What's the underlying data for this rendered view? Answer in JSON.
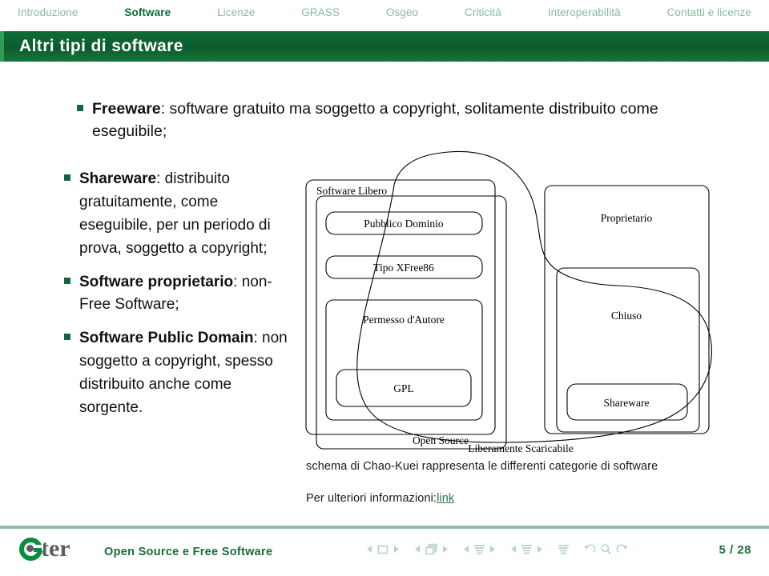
{
  "topnav": {
    "items": [
      {
        "label": "Introduzione",
        "active": false
      },
      {
        "label": "Software",
        "active": true
      },
      {
        "label": "Licenze",
        "active": false
      },
      {
        "label": "GRASS",
        "active": false
      },
      {
        "label": "Osgeo",
        "active": false
      },
      {
        "label": "Criticità",
        "active": false
      },
      {
        "label": "Interoperabilità",
        "active": false
      },
      {
        "label": "Contatti e licenze",
        "active": false
      }
    ],
    "inactive_color": "#84bc9c",
    "active_color": "#0b6b36"
  },
  "title": {
    "text": "Altri tipi di software",
    "bar_color": "#0c5c2c",
    "stripe_color": "#2f9c57",
    "text_color": "#ffffff"
  },
  "content": {
    "top_bullet": {
      "term": "Freeware",
      "rest": ": software gratuito ma soggetto a copyright, solitamente distribuito come eseguibile;"
    },
    "left_bullets": [
      {
        "term": "Shareware",
        "rest": ": distribuito gratuitamente, come eseguibile, per un periodo di prova, soggetto a copyright;"
      },
      {
        "term": "Software proprietario",
        "rest": ": non-Free Software;"
      },
      {
        "term": "Software Public Domain",
        "rest": ": non soggetto a copyright, spesso distribuito anche come sorgente."
      }
    ],
    "bullet_color": "#14673a"
  },
  "diagram": {
    "labels": {
      "software_libero": "Software Libero",
      "pubblico_dominio": "Pubblico Dominio",
      "tipo_xfree86": "Tipo XFree86",
      "permesso_autore": "Permesso d'Autore",
      "gpl": "GPL",
      "open_source": "Open Source",
      "proprietario": "Proprietario",
      "chiuso": "Chiuso",
      "shareware": "Shareware",
      "liberamente_scaricabile": "Liberamente Scaricabile"
    }
  },
  "captions": {
    "line1": "schema di Chao-Kuei rappresenta le differenti categorie di software",
    "line2_prefix": "Per ulteriori informazioni:",
    "line2_link": "link",
    "link_color": "#1f7a45"
  },
  "footer": {
    "logo_text": "ter",
    "logo_green": "#0b8c3e",
    "logo_gray": "#5d5d5d",
    "title": "Open Source e Free Software",
    "page": "5 / 28",
    "nav_color": "#b9d4c4",
    "rule_color": "#8fc0a4",
    "nav_buttons": [
      "prev-slide-icon",
      "slide-icon",
      "next-slide-icon",
      "prev-frame-icon",
      "frames-icon",
      "next-frame-icon",
      "prev-subsection-icon",
      "subsection-icon",
      "next-subsection-icon",
      "prev-section-icon",
      "section-icon",
      "next-section-icon",
      "presentation-icon",
      "back-icon",
      "search-icon",
      "forward-icon"
    ]
  }
}
